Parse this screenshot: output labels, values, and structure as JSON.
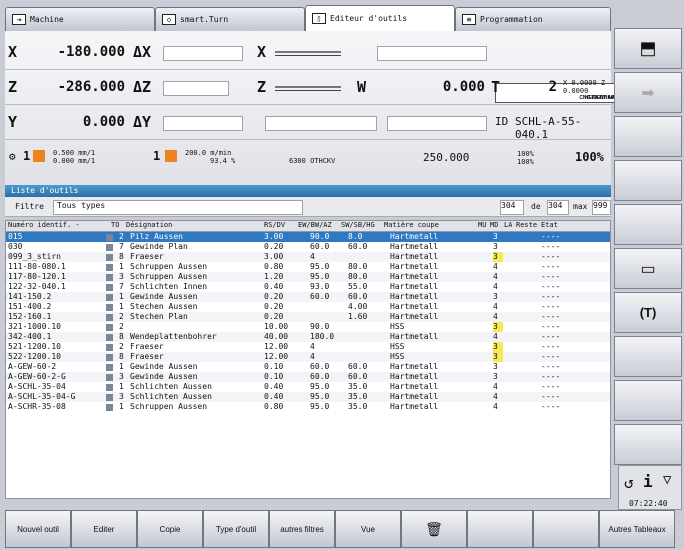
{
  "tabs": [
    {
      "label": "Machine"
    },
    {
      "label": "smart.Turn"
    },
    {
      "label": "Editeur d'outils"
    },
    {
      "label": "Programmation"
    }
  ],
  "axes": {
    "x": "X",
    "z": "Z",
    "y": "Y",
    "x_value": "-180.000",
    "z_value": "-286.000",
    "y_value": "0.000",
    "delta_x": "ΔX",
    "delta_z": "ΔZ",
    "delta_y": "ΔY",
    "x2": "X",
    "z2": "Z",
    "w_label": "W",
    "w_value": "0.000",
    "t_label": "T",
    "t_value": "2",
    "t_small": "X 0.0000 Z 0.0000"
  },
  "controller": {
    "name": "CNC PILOT 640",
    "maker": "HEIDENHAIN",
    "id_label": "ID",
    "id_value": "SCHL-A-55-040.1"
  },
  "feeds": {
    "f1": "0.500 mm/1",
    "f2": "0.000 mm/1",
    "s_value": "200.0 m/min",
    "s_small": "93.4 %",
    "rpm": "6300 OTHCKV",
    "speed": "250.000",
    "f_pct": "100%",
    "r_pct": "100%",
    "s_pct": "100%",
    "spindle": "1",
    "tool": "1"
  },
  "list": {
    "title": "Liste d'outils",
    "filter_label": "Filtre",
    "filter_value": "Tous types",
    "count": "304",
    "of": "de",
    "total": "304",
    "max_label": "max",
    "max": "999"
  },
  "headers": {
    "id": "Numéro identif. -",
    "to": "TO",
    "name": "Désignation",
    "rs": "RS/DV",
    "ew": "EW/BW/AZ",
    "sw": "SW/SB/HG",
    "mat": "Matière coupe",
    "mu": "MU",
    "md": "MD",
    "la": "LA",
    "reste": "Reste",
    "etat": "Etat"
  },
  "rows": [
    {
      "id": "015",
      "to": "2",
      "name": "Pilz Aussen",
      "rs": "3.00",
      "ew": "90.0",
      "sw": "8.0",
      "mat": "Hartmetall",
      "md": "3",
      "etat": "----",
      "yel": false
    },
    {
      "id": "030",
      "to": "7",
      "name": "Gewinde Plan",
      "rs": "0.20",
      "ew": "60.0",
      "sw": "60.0",
      "mat": "Hartmetall",
      "md": "3",
      "etat": "----",
      "yel": false
    },
    {
      "id": "099_3_stirn",
      "to": "8",
      "name": "Fraeser",
      "rs": "3.00",
      "ew": "4",
      "sw": "",
      "mat": "Hartmetall",
      "md": "3",
      "etat": "----",
      "yel": true
    },
    {
      "id": "111-80-080.1",
      "to": "1",
      "name": "Schruppen Aussen",
      "rs": "0.80",
      "ew": "95.0",
      "sw": "80.0",
      "mat": "Hartmetall",
      "md": "4",
      "etat": "----",
      "yel": false
    },
    {
      "id": "117-80-120.1",
      "to": "3",
      "name": "Schruppen Aussen",
      "rs": "1.20",
      "ew": "95.0",
      "sw": "80.0",
      "mat": "Hartmetall",
      "md": "4",
      "etat": "----",
      "yel": false
    },
    {
      "id": "122-32-040.1",
      "to": "7",
      "name": "Schlichten Innen",
      "rs": "0.40",
      "ew": "93.0",
      "sw": "55.0",
      "mat": "Hartmetall",
      "md": "4",
      "etat": "----",
      "yel": false
    },
    {
      "id": "141-150.2",
      "to": "1",
      "name": "Gewinde Aussen",
      "rs": "0.20",
      "ew": "60.0",
      "sw": "60.0",
      "mat": "Hartmetall",
      "md": "3",
      "etat": "----",
      "yel": false
    },
    {
      "id": "151-400.2",
      "to": "1",
      "name": "Stechen Aussen",
      "rs": "0.20",
      "ew": "",
      "sw": "4.00",
      "mat": "Hartmetall",
      "md": "4",
      "etat": "----",
      "yel": false
    },
    {
      "id": "152-160.1",
      "to": "2",
      "name": "Stechen Plan",
      "rs": "0.20",
      "ew": "",
      "sw": "1.60",
      "mat": "Hartmetall",
      "md": "4",
      "etat": "----",
      "yel": false
    },
    {
      "id": "321-1000.10",
      "to": "2",
      "name": "",
      "rs": "10.00",
      "ew": "90.0",
      "sw": "",
      "mat": "HSS",
      "md": "3",
      "etat": "----",
      "yel": true
    },
    {
      "id": "342-400.1",
      "to": "8",
      "name": "Wendeplattenbohrer",
      "rs": "40.00",
      "ew": "180.0",
      "sw": "",
      "mat": "Hartmetall",
      "md": "4",
      "etat": "----",
      "yel": false
    },
    {
      "id": "521-1200.10",
      "to": "2",
      "name": "Fraeser",
      "rs": "12.00",
      "ew": "4",
      "sw": "",
      "mat": "HSS",
      "md": "3",
      "etat": "----",
      "yel": true
    },
    {
      "id": "522-1200.10",
      "to": "8",
      "name": "Fraeser",
      "rs": "12.00",
      "ew": "4",
      "sw": "",
      "mat": "HSS",
      "md": "3",
      "etat": "----",
      "yel": true
    },
    {
      "id": "A-GEW-60-2",
      "to": "1",
      "name": "Gewinde Aussen",
      "rs": "0.10",
      "ew": "60.0",
      "sw": "60.0",
      "mat": "Hartmetall",
      "md": "3",
      "etat": "----",
      "yel": false
    },
    {
      "id": "A-GEW-60-2-G",
      "to": "3",
      "name": "Gewinde Aussen",
      "rs": "0.10",
      "ew": "60.0",
      "sw": "60.0",
      "mat": "Hartmetall",
      "md": "3",
      "etat": "----",
      "yel": false
    },
    {
      "id": "A-SCHL-35-04",
      "to": "1",
      "name": "Schlichten Aussen",
      "rs": "0.40",
      "ew": "95.0",
      "sw": "35.0",
      "mat": "Hartmetall",
      "md": "4",
      "etat": "----",
      "yel": false
    },
    {
      "id": "A-SCHL-35-04-G",
      "to": "3",
      "name": "Schlichten Aussen",
      "rs": "0.40",
      "ew": "95.0",
      "sw": "35.0",
      "mat": "Hartmetall",
      "md": "4",
      "etat": "----",
      "yel": false
    },
    {
      "id": "A-SCHR-35-08",
      "to": "1",
      "name": "Schruppen Aussen",
      "rs": "0.80",
      "ew": "95.0",
      "sw": "35.0",
      "mat": "Hartmetall",
      "md": "4",
      "etat": "----",
      "yel": false
    }
  ],
  "status": {
    "clock": "07:22:40"
  },
  "buttons": {
    "new": "Nouvel outil",
    "edit": "Editer",
    "copy": "Copie",
    "type": "Type d'outil",
    "filters": "autres filtres",
    "view": "Vue",
    "tables": "Autres Tableaux"
  }
}
